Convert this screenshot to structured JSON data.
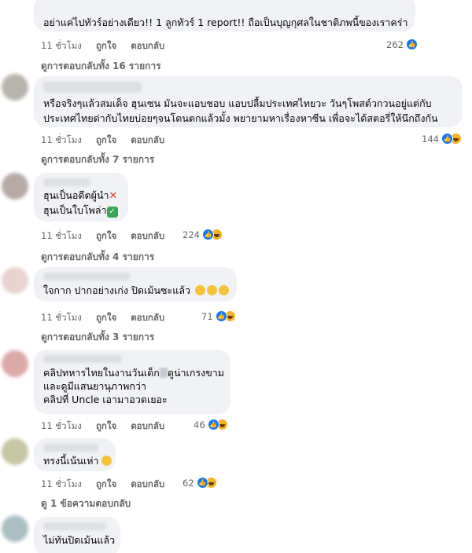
{
  "action_labels": {
    "like": "ถูกใจ",
    "reply": "ตอบกลับ"
  },
  "comments": [
    {
      "lines": [
        "อย่าแค่ไปทัวร์อย่างเดียว!! 1 ลูกทัวร์ 1 report!! ถือเป็นบุญกุศลในชาติภพนี้ของเราคร่า"
      ],
      "time": "11 ชั่วโมง",
      "reactions": "262",
      "replies": "ดูการตอบกลับทั้ง 16 รายการ"
    },
    {
      "lines": [
        "หรือจริงๆแล้วสมเด็จ ฮุนเซน มันจะแอบชอบ แอบปลื้มประเทศไทยวะ วันๆโพสต์วกวนอยู่แต่กับ",
        "ประเทศไทยด่ากับไทยบ่อยๆจนโดนตกแล้วมั้ง พยายามหาเรื่องหาซีน เพื่อจะได้สตอรี่ให้นึกถึงกัน"
      ],
      "time": "11 ชั่วโมง",
      "reactions": "144",
      "replies": "ดูการตอบกลับทั้ง 7 รายการ"
    },
    {
      "lines": [
        "ฮุนเป็นอดีตผู้นำ",
        "ฮุนเป็นใบโพล่า"
      ],
      "time": "11 ชั่วโมง",
      "reactions": "224",
      "replies": "ดูการตอบกลับทั้ง 4 รายการ"
    },
    {
      "lines": [
        "ใจกาก ปากอย่างเก่ง ปิดเม้นซะแล้ว"
      ],
      "time": "11 ชั่วโมง",
      "reactions": "71",
      "replies": "ดูการตอบกลับทั้ง 3 รายการ"
    },
    {
      "lines": [
        "คลิปทหารไทยในงานวันเด็ก",
        "ดูน่าเกรงขาม",
        "และดูมีแสนยานุภาพกว่า",
        "คลิปที่ Uncle เอามาอวดเยอะ"
      ],
      "time": "11 ชั่วโมง",
      "reactions": "46"
    },
    {
      "lines": [
        "ทรงนี้เน้นเห่า"
      ],
      "time": "11 ชั่วโมง",
      "reactions": "62",
      "replies": "ดู 1 ข้อความตอบกลับ"
    },
    {
      "lines": [
        "ไม่ทันปิดเม้นแล้ว"
      ]
    }
  ],
  "icons": {
    "like": "like-reaction-icon",
    "haha": "haha-reaction-icon"
  },
  "colors": {
    "bubble": "#f0f2f5",
    "meta": "#65676b",
    "like": "#1877f2",
    "haha": "#f7b125"
  }
}
